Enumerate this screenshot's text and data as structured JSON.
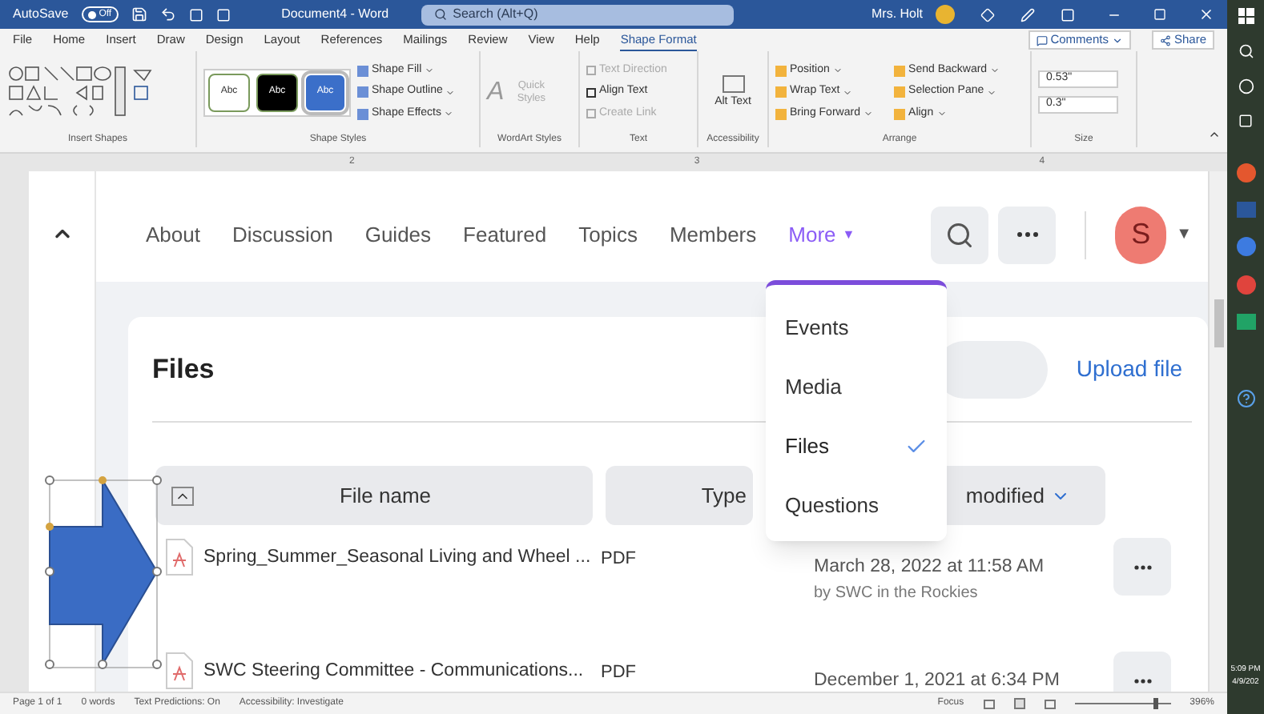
{
  "title_bar": {
    "autosave_label": "AutoSave",
    "autosave_toggle": {
      "label": "Off",
      "on": false
    },
    "document_title": "Document4 - Word",
    "search_placeholder": "Search (Alt+Q)",
    "user_name": "Mrs. Holt"
  },
  "ribbon_tabs": [
    {
      "label": "File",
      "selected": false
    },
    {
      "label": "Home",
      "selected": false
    },
    {
      "label": "Insert",
      "selected": false
    },
    {
      "label": "Draw",
      "selected": false
    },
    {
      "label": "Design",
      "selected": false
    },
    {
      "label": "Layout",
      "selected": false
    },
    {
      "label": "References",
      "selected": false
    },
    {
      "label": "Mailings",
      "selected": false
    },
    {
      "label": "Review",
      "selected": false
    },
    {
      "label": "View",
      "selected": false
    },
    {
      "label": "Help",
      "selected": false
    },
    {
      "label": "Shape Format",
      "selected": true
    }
  ],
  "comments_button": "Comments",
  "share_button": "Share",
  "ribbon": {
    "insert_shapes": {
      "label": "Insert Shapes"
    },
    "shape_styles": {
      "label": "Shape Styles",
      "swatches": [
        {
          "text": "Abc",
          "color": "#ffffff",
          "selected": false
        },
        {
          "text": "Abc",
          "color": "#000000",
          "selected": false
        },
        {
          "text": "Abc",
          "color": "#3b6fc9",
          "selected": true
        }
      ],
      "commands": [
        "Shape Fill",
        "Shape Outline",
        "Shape Effects"
      ]
    },
    "wordart_styles": {
      "label": "WordArt Styles",
      "letter": "A",
      "quick_styles": "Quick Styles"
    },
    "text": {
      "label": "Text",
      "commands": [
        {
          "label": "Text Direction",
          "disabled": true
        },
        {
          "label": "Align Text",
          "disabled": false
        },
        {
          "label": "Create Link",
          "disabled": true
        }
      ]
    },
    "accessibility": {
      "label": "Accessibility",
      "alt_text": "Alt Text"
    },
    "arrange": {
      "label": "Arrange",
      "commands": [
        "Position",
        "Wrap Text",
        "Bring Forward",
        "Send Backward",
        "Selection Pane",
        "Align"
      ]
    },
    "size": {
      "label": "Size",
      "height": "0.53\"",
      "width": "0.3\""
    }
  },
  "ruler_numbers": [
    "2",
    "3",
    "4"
  ],
  "web_page": {
    "nav": [
      {
        "label": "About",
        "selected": false
      },
      {
        "label": "Discussion",
        "selected": false
      },
      {
        "label": "Guides",
        "selected": false
      },
      {
        "label": "Featured",
        "selected": false
      },
      {
        "label": "Topics",
        "selected": false
      },
      {
        "label": "Members",
        "selected": false
      },
      {
        "label": "More",
        "selected": true,
        "caret": "▼"
      }
    ],
    "avatar_letter": "S",
    "avatar_caret": "▼",
    "heading": "Files",
    "upload_link": "Upload file",
    "columns": [
      "File name",
      "Type",
      "modified"
    ],
    "rows": [
      {
        "name": "Spring_Summer_Seasonal Living and Wheel ...",
        "type": "PDF",
        "date": "March 28, 2022 at 11:58 AM",
        "by": "by SWC in the Rockies"
      },
      {
        "name": "SWC Steering Committee - Communications...",
        "type": "PDF",
        "date": "December 1, 2021 at 6:34 PM"
      }
    ],
    "more_menu": [
      {
        "label": "Events",
        "selected": false
      },
      {
        "label": "Media",
        "selected": false
      },
      {
        "label": "Files",
        "selected": true
      },
      {
        "label": "Questions",
        "selected": false
      }
    ]
  },
  "status_bar": {
    "page": "Page 1 of 1",
    "words": "0 words",
    "text_predictions": "Text Predictions: On",
    "accessibility": "Accessibility: Investigate",
    "focus": "Focus",
    "zoom": "396%",
    "zoom_slider": {
      "level": 0.85
    }
  },
  "taskbar": {
    "time": "5:09 PM",
    "date": "4/9/202"
  }
}
